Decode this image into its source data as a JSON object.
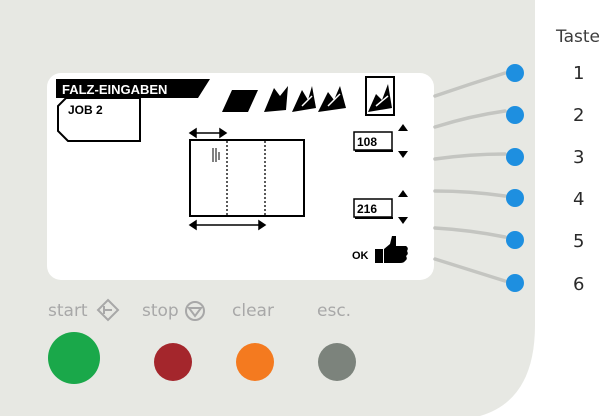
{
  "panel": {
    "taste_label": "Taste",
    "keys": [
      "1",
      "2",
      "3",
      "4",
      "5",
      "6"
    ],
    "key_color": "#1e8fe0"
  },
  "screen": {
    "title": "FALZ-EINGABEN",
    "job_label": "JOB  2",
    "value_1": "108",
    "value_2": "216",
    "ok_label": "OK"
  },
  "controls": {
    "start_label": "start",
    "stop_label": "stop",
    "clear_label": "clear",
    "esc_label": "esc.",
    "start_color": "#1aa84a",
    "stop_color": "#a4262c",
    "clear_color": "#f47a1f",
    "esc_color": "#7c837c"
  }
}
